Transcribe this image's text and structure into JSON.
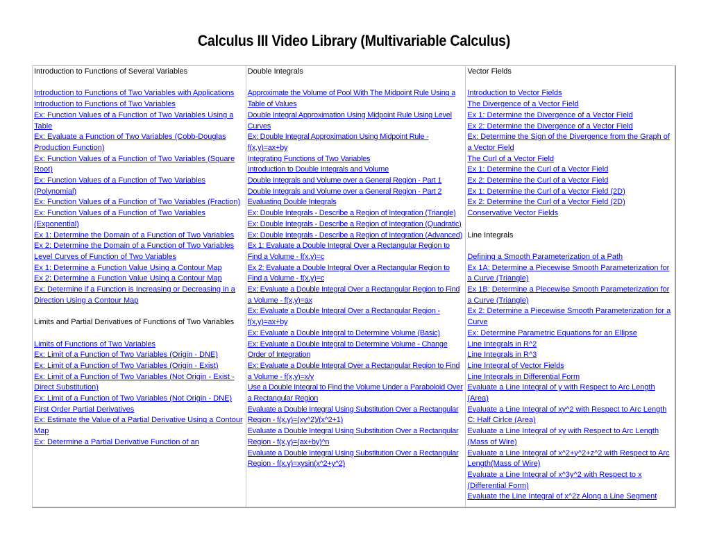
{
  "title": "Calculus III Video Library (Multivariable Calculus)",
  "link_color": "#0000ee",
  "columns": [
    {
      "header": "Introduction to Functions of Several Variables",
      "links": [
        "Introduction to Functions of Two Variables with Applications",
        "Introduction to Functions of Two Variables",
        "Ex: Function Values of a Function of Two Variables Using a Table",
        "Ex: Evaluate a Function of Two Variables (Cobb-Douglas Production Function)",
        "Ex: Function Values of a Function of Two Variables (Square Root)",
        "Ex: Function Values of a Function of Two Variables (Polynomial)",
        "Ex: Function Values of a Function of Two Variables (Fraction)",
        "Ex: Function Values of a Function of Two Variables (Exponential)",
        "Ex 1: Determine the Domain of a Function of Two Variables",
        "Ex 2: Determine the Domain of a Function of Two Variables",
        "Level Curves of Function of Two Variables",
        "Ex 1: Determine a Function Value Using a Contour Map",
        "Ex 2: Determine a Function Value Using a Contour Map",
        "Ex: Determine if a Function is Increasing or Decreasing in a Direction Using a Contour Map"
      ],
      "section2_header": "Limits and Partial Derivatives of Functions of Two Variables",
      "section2_links": [
        "Limits of Functions of Two Variables",
        "Ex: Limit of a Function of Two Variables (Origin - DNE)",
        "Ex: Limit of a Function of Two Variables (Origin - Exist)",
        "Ex: Limit of a Function of Two Variables (Not Origin - Exist - Direct Substitution)",
        "Ex: Limit of a Function of Two Variables (Not Origin - DNE)",
        "First Order Partial Derivatives",
        "Ex: Estimate the Value of a Partial Derivative Using a Contour Map",
        "Ex: Determine a Partial Derivative Function of an"
      ]
    },
    {
      "header": "Double Integrals",
      "links": [
        "Approximate the Volume of Pool With The Midpoint Rule Using a Table of Values",
        "Double Integral Approximation Using Midpoint Rule Using Level Curves",
        "Ex: Double Integral Approximation Using Midpoint Rule - f(x,y)=ax+by",
        "Integrating Functions of Two Variables",
        "Introduction to Double Integrals and Volume",
        "Double Integrals and Volume over a General Region - Part 1",
        "Double Integrals and Volume over a General Region - Part 2",
        "Evaluating Double Integrals",
        "Ex: Double Integrals - Describe a Region of Integration (Triangle)",
        "Ex: Double Integrals - Describe a Region of Integration (Quadratic)",
        "Ex: Double Integrals - Describe a Region of Integration (Advanced)",
        "Ex 1: Evaluate a Double Integral Over a Rectangular Region to Find a Volume - f(x,y)=c",
        "Ex 2: Evaluate a Double Integral Over a Rectangular Region to Find a Volume - f(x,y)=c",
        "Ex: Evaluate a Double Integral Over a Rectangular Region to Find a Volume - f(x,y)=ax",
        "Ex: Evaluate a Double Integral Over a Rectangular Region  - f(x,y)=ax+by",
        "Ex: Evaluate a Double Integral to Determine Volume (Basic)",
        "Ex: Evaluate a Double Integral to Determine Volume - Change Order of Integration",
        "Ex: Evaluate a Double Integral Over a Rectangular Region to Find a Volume - f(x,y)=x/y",
        "Use a Double Integral to Find the Volume Under a Paraboloid Over a Rectangular Region",
        "Evaluate a Double Integral Using Substitution Over a Rectangular Region - f(x,y)=(xy^2)/(x^2+1)",
        "Evaluate a Double Integral Using Substitution Over a Rectangular Region - f(x,y)=(ax+by)^n",
        "Evaluate a Double Integral Using Substitution Over a Rectangular Region - f(x,y)=xysin(x^2+y^2)"
      ]
    },
    {
      "header": "Vector Fields",
      "links": [
        "Introduction to Vector Fields",
        "The Divergence of a Vector Field",
        "Ex 1: Determine the Divergence of a Vector Field",
        "Ex 2: Determine the Divergence of a Vector Field",
        "Ex: Determine the Sign of the Divergence from the Graph of a Vector Field",
        "The Curl of a Vector Field",
        "Ex 1: Determine the Curl of a Vector Field",
        "Ex 2: Determine the Curl of a Vector Field",
        "Ex 1: Determine the Curl of a Vector Field (2D)",
        "Ex 2: Determine the Curl of a Vector Field (2D)",
        "Conservative Vector Fields"
      ],
      "section2_header": "Line Integrals",
      "section2_links": [
        "Defining a Smooth Parameterization of a Path",
        "Ex 1A: Determine a Piecewise Smooth Parameterization for a Curve (Triangle)",
        "Ex 1B: Determine a Piecewise Smooth Parameterization for a Curve (Triangle)",
        "Ex 2: Determine a Piecewise Smooth Parameterization for a Curve",
        "Ex: Determine Parametric Equations for an Ellipse",
        "Line Integrals in R^2",
        "Line Integrals in R^3",
        "Line Integral of Vector Fields",
        "Line Integrals in Differential Form",
        "Evaluate a Line Integral of y with Respect to Arc Length (Area)",
        "Evaluate a Line Integral of xy^2  with Respect to Arc Length C: Half Cirlce  (Area)",
        "Evaluate a Line Integral of xy with Respect to Arc Length (Mass of Wire)",
        "Evaluate a Line Integral of x^2+y^2+z^2 with Respect to Arc Length(Mass of Wire)",
        "Evaluate a Line Integral of x^3y^2 with Respect to x (Differential Form)",
        "Evaluate the Line Integral of x^2z Along a Line Segment"
      ]
    }
  ]
}
